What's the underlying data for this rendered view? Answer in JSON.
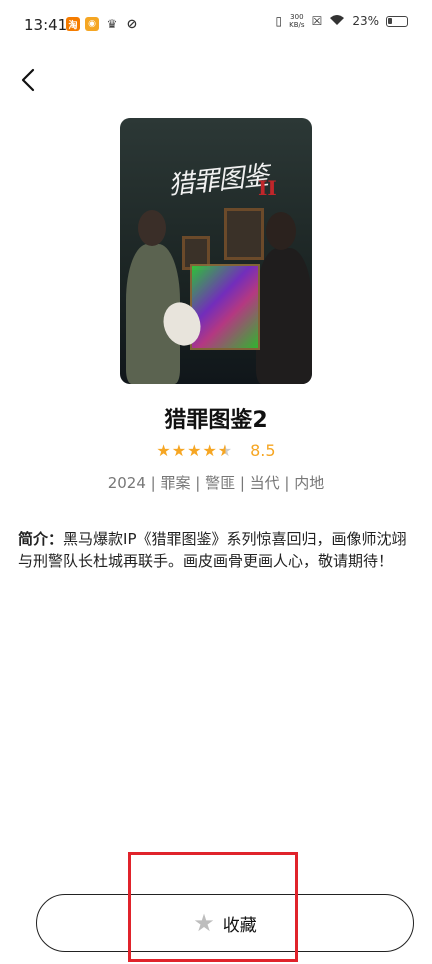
{
  "status_bar": {
    "time": "13:41",
    "net_speed_value": "300",
    "net_speed_unit": "KB/s",
    "battery": "23%",
    "app_icons": [
      "taobao-icon",
      "app-icon",
      "crown-icon",
      "link-icon"
    ]
  },
  "show": {
    "poster_title": "猎罪图鉴",
    "poster_title_num": "II",
    "title": "猎罪图鉴2",
    "rating": "8.5",
    "stars": 4.5,
    "meta": "2024 | 罪案 | 警匪 | 当代 | 内地"
  },
  "synopsis": {
    "label": "简介：",
    "text": "黑马爆款IP《猎罪图鉴》系列惊喜回归，画像师沈翊与刑警队长杜城再联手。画皮画骨更画人心，敬请期待！"
  },
  "favorite_button": {
    "label": "收藏",
    "icon": "star-icon"
  },
  "colors": {
    "accent": "#f6a623",
    "highlight": "#e0232b"
  }
}
